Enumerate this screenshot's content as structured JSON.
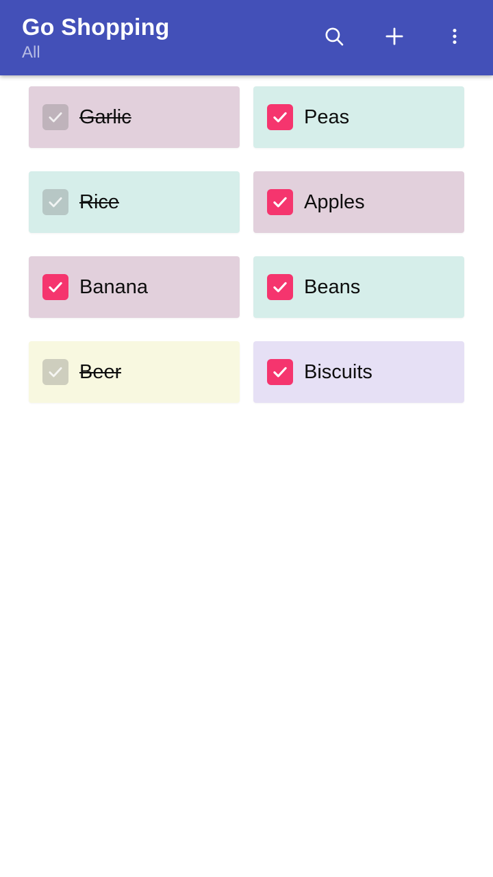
{
  "appbar": {
    "title": "Go Shopping",
    "subtitle": "All",
    "background_color": "#4350b8",
    "actions": [
      {
        "name": "search-icon",
        "label": "Search"
      },
      {
        "name": "add-icon",
        "label": "Add item"
      },
      {
        "name": "overflow-menu-icon",
        "label": "More options"
      }
    ]
  },
  "colors": {
    "checked_checkbox": "#f5356e",
    "done_checkbox": "#b6b0b4",
    "text": "#0d0d0d"
  },
  "list": {
    "items": [
      {
        "label": "Garlic",
        "state": "done",
        "card_color": "#e2d0dc"
      },
      {
        "label": "Peas",
        "state": "checked",
        "card_color": "#d6eeea"
      },
      {
        "label": "Rice",
        "state": "done",
        "card_color": "#d6eeea"
      },
      {
        "label": "Apples",
        "state": "checked",
        "card_color": "#e2d0dc"
      },
      {
        "label": "Banana",
        "state": "checked",
        "card_color": "#e2d0dc"
      },
      {
        "label": "Beans",
        "state": "checked",
        "card_color": "#d6eeea"
      },
      {
        "label": "Beer",
        "state": "done",
        "card_color": "#f8f8e0"
      },
      {
        "label": "Biscuits",
        "state": "checked",
        "card_color": "#e6e0f5"
      }
    ]
  }
}
